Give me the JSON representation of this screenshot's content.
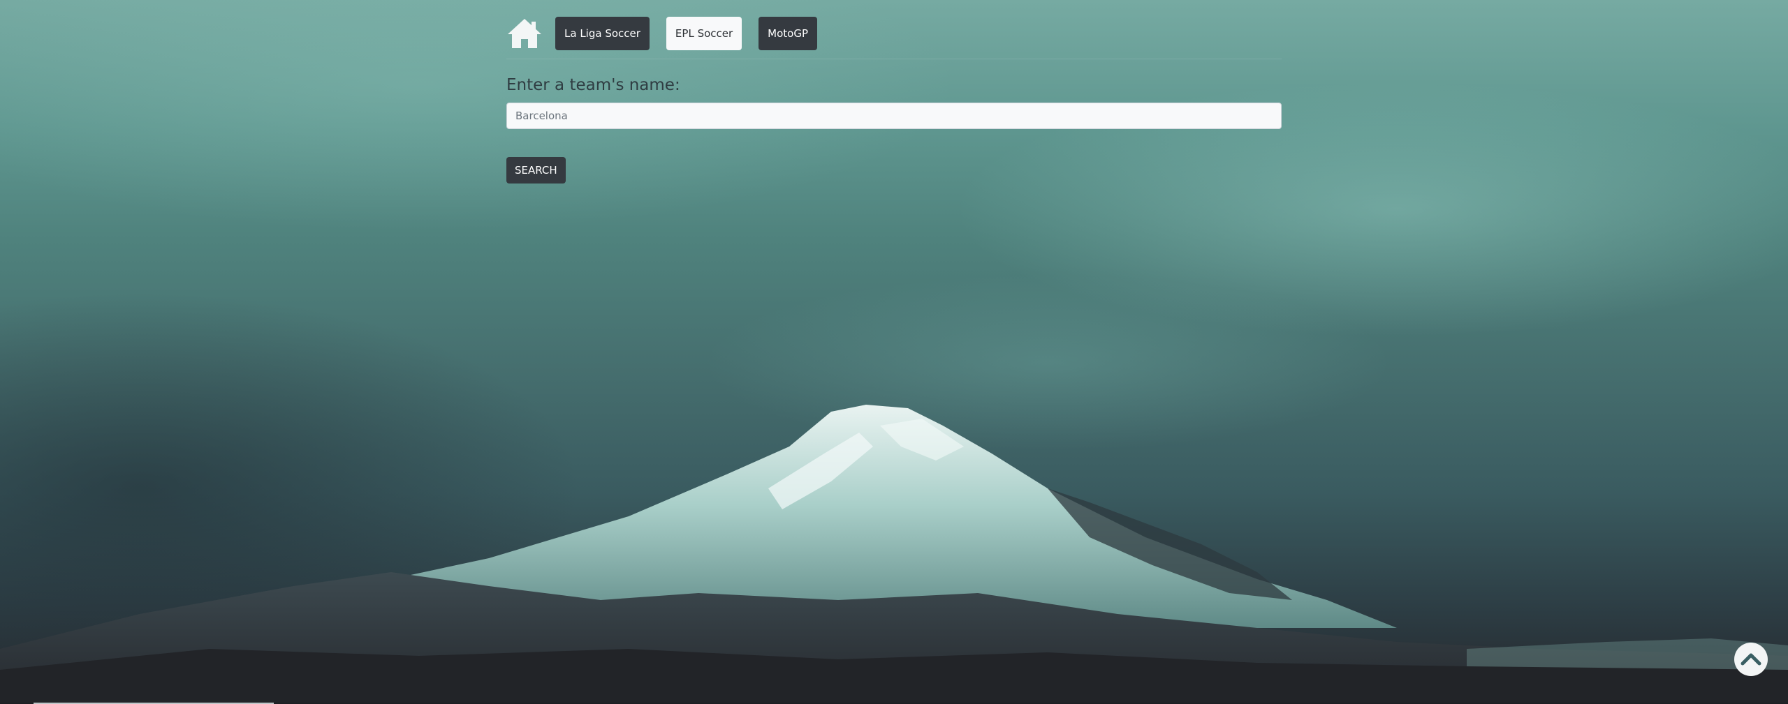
{
  "nav": {
    "home_icon": "home-icon",
    "items": [
      {
        "label": "La Liga Soccer",
        "style": "dark"
      },
      {
        "label": "EPL Soccer",
        "style": "light"
      },
      {
        "label": "MotoGP",
        "style": "dark"
      }
    ]
  },
  "search": {
    "label": "Enter a team's name:",
    "placeholder": "Barcelona",
    "value": "",
    "button_label": "SEARCH"
  },
  "scroll_top": {
    "icon": "chevron-up-icon"
  },
  "colors": {
    "dark_button": "#353a40",
    "light_button": "#f8f9fa",
    "sky_top": "#76aaa2",
    "ground": "#24262b"
  }
}
